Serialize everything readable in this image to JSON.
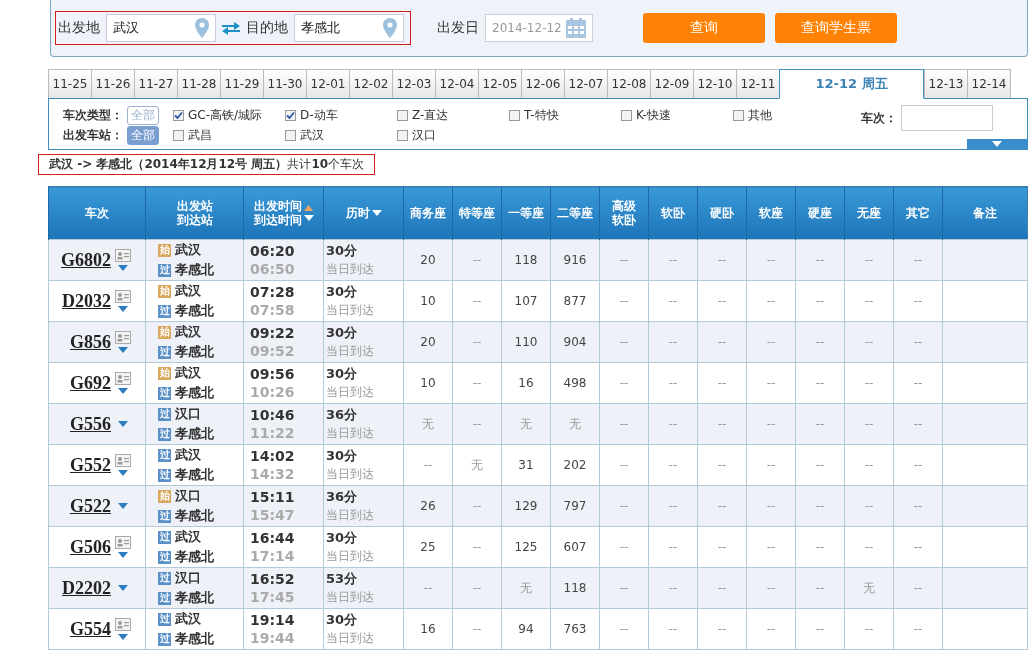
{
  "search": {
    "origin_label": "出发地",
    "origin_value": "武汉",
    "dest_label": "目的地",
    "dest_value": "孝感北",
    "date_label": "出发日",
    "date_value": "2014-12-12",
    "buttons": [
      "查询",
      "查询学生票"
    ]
  },
  "date_tabs": [
    {
      "label": "11-25",
      "selected": false
    },
    {
      "label": "11-26",
      "selected": false
    },
    {
      "label": "11-27",
      "selected": false
    },
    {
      "label": "11-28",
      "selected": false
    },
    {
      "label": "11-29",
      "selected": false
    },
    {
      "label": "11-30",
      "selected": false
    },
    {
      "label": "12-01",
      "selected": false
    },
    {
      "label": "12-02",
      "selected": false
    },
    {
      "label": "12-03",
      "selected": false
    },
    {
      "label": "12-04",
      "selected": false
    },
    {
      "label": "12-05",
      "selected": false
    },
    {
      "label": "12-06",
      "selected": false
    },
    {
      "label": "12-07",
      "selected": false
    },
    {
      "label": "12-08",
      "selected": false
    },
    {
      "label": "12-09",
      "selected": false
    },
    {
      "label": "12-10",
      "selected": false
    },
    {
      "label": "12-11",
      "selected": false
    },
    {
      "label": "12-12 周五",
      "selected": true
    },
    {
      "label": "12-13",
      "selected": false
    },
    {
      "label": "12-14",
      "selected": false
    }
  ],
  "filters": {
    "type_label": "车次类型：",
    "type_all": {
      "label": "全部",
      "selected": false
    },
    "types": [
      {
        "label": "GC-高铁/城际",
        "checked": true
      },
      {
        "label": "D-动车",
        "checked": true
      },
      {
        "label": "Z-直达",
        "checked": false
      },
      {
        "label": "T-特快",
        "checked": false
      },
      {
        "label": "K-快速",
        "checked": false
      },
      {
        "label": "其他",
        "checked": false
      }
    ],
    "station_label": "出发车站：",
    "station_all": {
      "label": "全部",
      "selected": true
    },
    "stations": [
      {
        "label": "武昌",
        "checked": false
      },
      {
        "label": "武汉",
        "checked": false
      },
      {
        "label": "汉口",
        "checked": false
      }
    ],
    "train_no_label": "车次："
  },
  "summary": "**武汉 -> 孝感北（2014年12月12号  周五）**共计**10**个车次",
  "table": {
    "columns": [
      {
        "lines": [
          "车次"
        ]
      },
      {
        "lines": [
          "出发站",
          "到达站"
        ]
      },
      {
        "lines": [
          "出发时间",
          "到达时间"
        ],
        "sort_up": true,
        "sort_down": true
      },
      {
        "lines": [
          "历时"
        ],
        "sort_down": true
      },
      {
        "lines": [
          "商务座"
        ]
      },
      {
        "lines": [
          "特等座"
        ]
      },
      {
        "lines": [
          "一等座"
        ]
      },
      {
        "lines": [
          "二等座"
        ]
      },
      {
        "lines": [
          "高级",
          "软卧"
        ]
      },
      {
        "lines": [
          "软卧"
        ]
      },
      {
        "lines": [
          "硬卧"
        ]
      },
      {
        "lines": [
          "软座"
        ]
      },
      {
        "lines": [
          "硬座"
        ]
      },
      {
        "lines": [
          "无座"
        ]
      },
      {
        "lines": [
          "其它"
        ]
      },
      {
        "lines": [
          "备注"
        ]
      }
    ],
    "rows": [
      {
        "train": "G6802",
        "info_icon": true,
        "from_badge": {
          "text": "始",
          "kind": "origin"
        },
        "from": "武汉",
        "to_badge": {
          "text": "过",
          "kind": "pass"
        },
        "to": "孝感北",
        "depart": "06:20",
        "arrive": "06:50",
        "duration": "30分",
        "arrival_day": "当日到达",
        "seats": [
          "20",
          "--",
          "118",
          "916",
          "--",
          "--",
          "--",
          "--",
          "--",
          "--",
          "--"
        ]
      },
      {
        "train": "D2032",
        "info_icon": true,
        "from_badge": {
          "text": "始",
          "kind": "origin"
        },
        "from": "武汉",
        "to_badge": {
          "text": "过",
          "kind": "pass"
        },
        "to": "孝感北",
        "depart": "07:28",
        "arrive": "07:58",
        "duration": "30分",
        "arrival_day": "当日到达",
        "seats": [
          "10",
          "--",
          "107",
          "877",
          "--",
          "--",
          "--",
          "--",
          "--",
          "--",
          "--"
        ]
      },
      {
        "train": "G856",
        "info_icon": true,
        "from_badge": {
          "text": "始",
          "kind": "origin"
        },
        "from": "武汉",
        "to_badge": {
          "text": "过",
          "kind": "pass"
        },
        "to": "孝感北",
        "depart": "09:22",
        "arrive": "09:52",
        "duration": "30分",
        "arrival_day": "当日到达",
        "seats": [
          "20",
          "--",
          "110",
          "904",
          "--",
          "--",
          "--",
          "--",
          "--",
          "--",
          "--"
        ]
      },
      {
        "train": "G692",
        "info_icon": true,
        "from_badge": {
          "text": "始",
          "kind": "origin"
        },
        "from": "武汉",
        "to_badge": {
          "text": "过",
          "kind": "pass"
        },
        "to": "孝感北",
        "depart": "09:56",
        "arrive": "10:26",
        "duration": "30分",
        "arrival_day": "当日到达",
        "seats": [
          "10",
          "--",
          "16",
          "498",
          "--",
          "--",
          "--",
          "--",
          "--",
          "--",
          "--"
        ]
      },
      {
        "train": "G556",
        "info_icon": false,
        "from_badge": {
          "text": "过",
          "kind": "pass"
        },
        "from": "汉口",
        "to_badge": {
          "text": "过",
          "kind": "pass"
        },
        "to": "孝感北",
        "depart": "10:46",
        "arrive": "11:22",
        "duration": "36分",
        "arrival_day": "当日到达",
        "seats": [
          "无",
          "--",
          "无",
          "无",
          "--",
          "--",
          "--",
          "--",
          "--",
          "--",
          "--"
        ]
      },
      {
        "train": "G552",
        "info_icon": true,
        "from_badge": {
          "text": "过",
          "kind": "pass"
        },
        "from": "武汉",
        "to_badge": {
          "text": "过",
          "kind": "pass"
        },
        "to": "孝感北",
        "depart": "14:02",
        "arrive": "14:32",
        "duration": "30分",
        "arrival_day": "当日到达",
        "seats": [
          "--",
          "无",
          "31",
          "202",
          "--",
          "--",
          "--",
          "--",
          "--",
          "--",
          "--"
        ]
      },
      {
        "train": "G522",
        "info_icon": false,
        "from_badge": {
          "text": "始",
          "kind": "origin"
        },
        "from": "汉口",
        "to_badge": {
          "text": "过",
          "kind": "pass"
        },
        "to": "孝感北",
        "depart": "15:11",
        "arrive": "15:47",
        "duration": "36分",
        "arrival_day": "当日到达",
        "seats": [
          "26",
          "--",
          "129",
          "797",
          "--",
          "--",
          "--",
          "--",
          "--",
          "--",
          "--"
        ]
      },
      {
        "train": "G506",
        "info_icon": true,
        "from_badge": {
          "text": "过",
          "kind": "pass"
        },
        "from": "武汉",
        "to_badge": {
          "text": "过",
          "kind": "pass"
        },
        "to": "孝感北",
        "depart": "16:44",
        "arrive": "17:14",
        "duration": "30分",
        "arrival_day": "当日到达",
        "seats": [
          "25",
          "--",
          "125",
          "607",
          "--",
          "--",
          "--",
          "--",
          "--",
          "--",
          "--"
        ]
      },
      {
        "train": "D2202",
        "info_icon": false,
        "from_badge": {
          "text": "过",
          "kind": "pass"
        },
        "from": "汉口",
        "to_badge": {
          "text": "过",
          "kind": "pass"
        },
        "to": "孝感北",
        "depart": "16:52",
        "arrive": "17:45",
        "duration": "53分",
        "arrival_day": "当日到达",
        "seats": [
          "--",
          "--",
          "无",
          "118",
          "--",
          "--",
          "--",
          "--",
          "--",
          "无",
          "--"
        ]
      },
      {
        "train": "G554",
        "info_icon": true,
        "from_badge": {
          "text": "过",
          "kind": "pass"
        },
        "from": "武汉",
        "to_badge": {
          "text": "过",
          "kind": "pass"
        },
        "to": "孝感北",
        "depart": "19:14",
        "arrive": "19:44",
        "duration": "30分",
        "arrival_day": "当日到达",
        "seats": [
          "16",
          "--",
          "94",
          "763",
          "--",
          "--",
          "--",
          "--",
          "--",
          "--",
          "--"
        ]
      }
    ]
  }
}
